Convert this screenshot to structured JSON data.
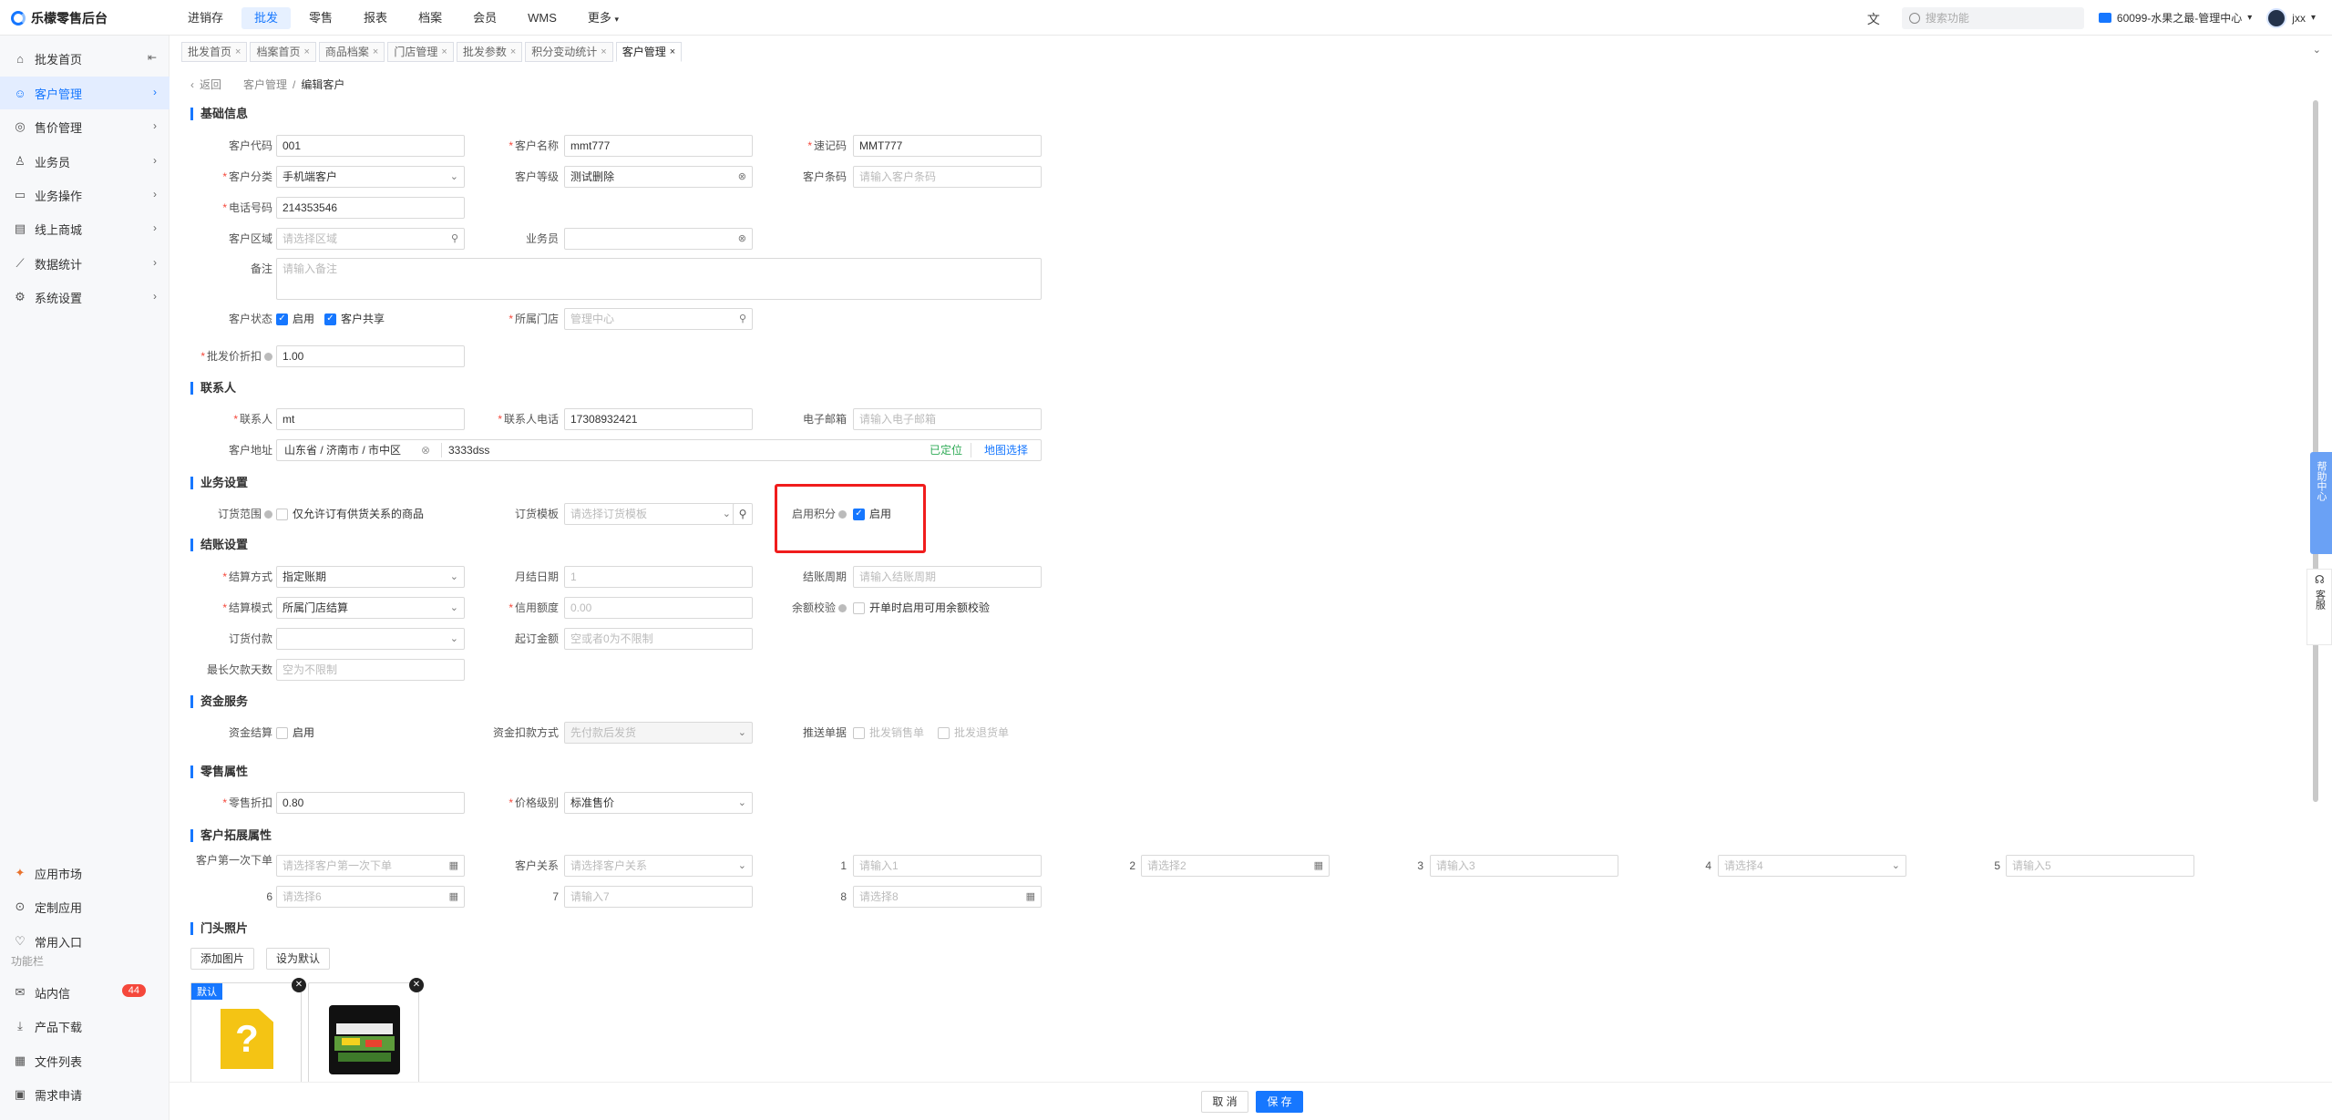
{
  "app": {
    "title": "乐檬零售后台"
  },
  "topnav": [
    "进销存",
    "批发",
    "零售",
    "报表",
    "档案",
    "会员",
    "WMS",
    "更多"
  ],
  "topnav_active": 1,
  "topbar": {
    "lang_icon": "translate-icon",
    "search_placeholder": "搜索功能",
    "store": "60099-水果之最-管理中心",
    "user": "jxx"
  },
  "sidebar": {
    "items": [
      {
        "label": "批发首页",
        "icon": "home-icon"
      },
      {
        "label": "客户管理",
        "icon": "user-icon"
      },
      {
        "label": "售价管理",
        "icon": "price-icon"
      },
      {
        "label": "业务员",
        "icon": "person-icon"
      },
      {
        "label": "业务操作",
        "icon": "operate-icon"
      },
      {
        "label": "线上商城",
        "icon": "shop-icon"
      },
      {
        "label": "数据统计",
        "icon": "chart-icon"
      },
      {
        "label": "系统设置",
        "icon": "settings-icon"
      }
    ],
    "bottom": [
      {
        "label": "应用市场",
        "icon": "app-market-icon"
      },
      {
        "label": "定制应用",
        "icon": "custom-app-icon"
      },
      {
        "label": "常用入口",
        "icon": "heart-icon"
      }
    ],
    "group_label": "功能栏",
    "funcs": [
      {
        "label": "站内信",
        "icon": "message-icon",
        "badge": "44"
      },
      {
        "label": "产品下载",
        "icon": "download-icon"
      },
      {
        "label": "文件列表",
        "icon": "file-list-icon"
      },
      {
        "label": "需求申请",
        "icon": "request-icon"
      }
    ]
  },
  "tabs": [
    "批发首页",
    "档案首页",
    "商品档案",
    "门店管理",
    "批发参数",
    "积分变动统计",
    "客户管理"
  ],
  "breadcrumb": {
    "back": "返回",
    "parent": "客户管理",
    "current": "编辑客户"
  },
  "sections": {
    "basic": "基础信息",
    "contact": "联系人",
    "business": "业务设置",
    "settle": "结账设置",
    "fund": "资金服务",
    "retail": "零售属性",
    "ext": "客户拓展属性",
    "photo": "门头照片"
  },
  "basic": {
    "code_label": "客户代码",
    "code": "001",
    "name_label": "客户名称",
    "name": "mmt777",
    "quick_label": "速记码",
    "quick": "MMT777",
    "cat_label": "客户分类",
    "cat": "手机端客户",
    "level_label": "客户等级",
    "level": "测试删除",
    "barcode_label": "客户条码",
    "barcode_ph": "请输入客户条码",
    "phone_label": "电话号码",
    "phone": "214353546",
    "region_label": "客户区域",
    "region_ph": "请选择区域",
    "sales_label": "业务员",
    "remark_label": "备注",
    "remark_ph": "请输入备注",
    "status_label": "客户状态",
    "status_enable": "启用",
    "status_share": "客户共享",
    "store_label": "所属门店",
    "store_ph": "管理中心",
    "discount_label": "批发价折扣",
    "discount": "1.00"
  },
  "contact": {
    "person_label": "联系人",
    "person": "mt",
    "phone_label": "联系人电话",
    "phone": "17308932421",
    "email_label": "电子邮箱",
    "email_ph": "请输入电子邮箱",
    "addr_label": "客户地址",
    "addr_region": "山东省 / 济南市 / 市中区",
    "addr_detail": "3333dss",
    "located": "已定位",
    "map": "地图选择"
  },
  "business": {
    "scope_label": "订货范围",
    "scope_opt": "仅允许订有供货关系的商品",
    "template_label": "订货模板",
    "template_ph": "请选择订货模板",
    "points_label": "启用积分",
    "points_opt": "启用"
  },
  "settle": {
    "method_label": "结算方式",
    "method": "指定账期",
    "monthly_label": "月结日期",
    "monthly_ph": "1",
    "cycle_label": "结账周期",
    "cycle_ph": "请输入结账周期",
    "mode_label": "结算模式",
    "mode": "所属门店结算",
    "credit_label": "信用额度",
    "credit_ph": "0.00",
    "balance_label": "余额校验",
    "balance_opt": "开单时启用可用余额校验",
    "pay_label": "订货付款",
    "min_label": "起订金额",
    "min_ph": "空或者0为不限制",
    "days_label": "最长欠款天数",
    "days_ph": "空为不限制"
  },
  "fund": {
    "settle_label": "资金结算",
    "settle_opt": "启用",
    "deduct_label": "资金扣款方式",
    "deduct_ph": "先付款后发货",
    "push_label": "推送单据",
    "push_opt1": "批发销售单",
    "push_opt2": "批发退货单"
  },
  "retail": {
    "discount_label": "零售折扣",
    "discount": "0.80",
    "price_label": "价格级别",
    "price": "标准售价"
  },
  "ext": {
    "first_label": "客户第一次下单",
    "first_ph": "请选择客户第一次下单",
    "rel_label": "客户关系",
    "rel_ph": "请选择客户关系",
    "f1_label": "1",
    "f1_ph": "请输入1",
    "f2_label": "2",
    "f2_ph": "请选择2",
    "f3_label": "3",
    "f3_ph": "请输入3",
    "f4_label": "4",
    "f4_ph": "请选择4",
    "f5_label": "5",
    "f5_ph": "请输入5",
    "f6_label": "6",
    "f6_ph": "请选择6",
    "f7_label": "7",
    "f7_ph": "请输入7",
    "f8_label": "8",
    "f8_ph": "请选择8"
  },
  "photo": {
    "add": "添加图片",
    "set_default": "设为默认",
    "default_badge": "默认"
  },
  "footer": {
    "cancel": "取 消",
    "save": "保 存"
  },
  "side_help": "帮助中心",
  "side_kefu": "客服",
  "colors": {
    "primary": "#1677ff",
    "highlight": "#f01c1c",
    "badge": "#f5483b"
  }
}
